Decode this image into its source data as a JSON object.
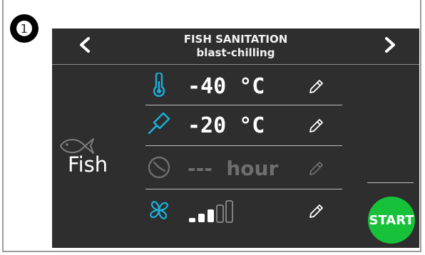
{
  "step": {
    "number": "❶"
  },
  "header": {
    "title": "FISH SANITATION",
    "subtitle": "blast-chilling",
    "prev_icon": "chevron-left-icon",
    "next_icon": "chevron-right-icon"
  },
  "category": {
    "label": "Fish",
    "icon": "fish-icon"
  },
  "settings": [
    {
      "id": "chamber-temperature",
      "icon": "thermometer-icon",
      "value": "-40",
      "unit": "°C",
      "enabled": true
    },
    {
      "id": "probe-temperature",
      "icon": "core-probe-icon",
      "value": "-20",
      "unit": "°C",
      "enabled": true
    },
    {
      "id": "time",
      "icon": "clock-icon",
      "value": "---",
      "unit": "hour",
      "enabled": false
    },
    {
      "id": "fan-speed",
      "icon": "fan-icon",
      "level": 3,
      "max_level": 5,
      "enabled": true
    }
  ],
  "actions": {
    "start_label": "START"
  },
  "colors": {
    "accent": "#1ab0d9",
    "screen_bg": "#2e2e2e",
    "start": "#17c23a",
    "disabled": "#6e6e6e"
  }
}
